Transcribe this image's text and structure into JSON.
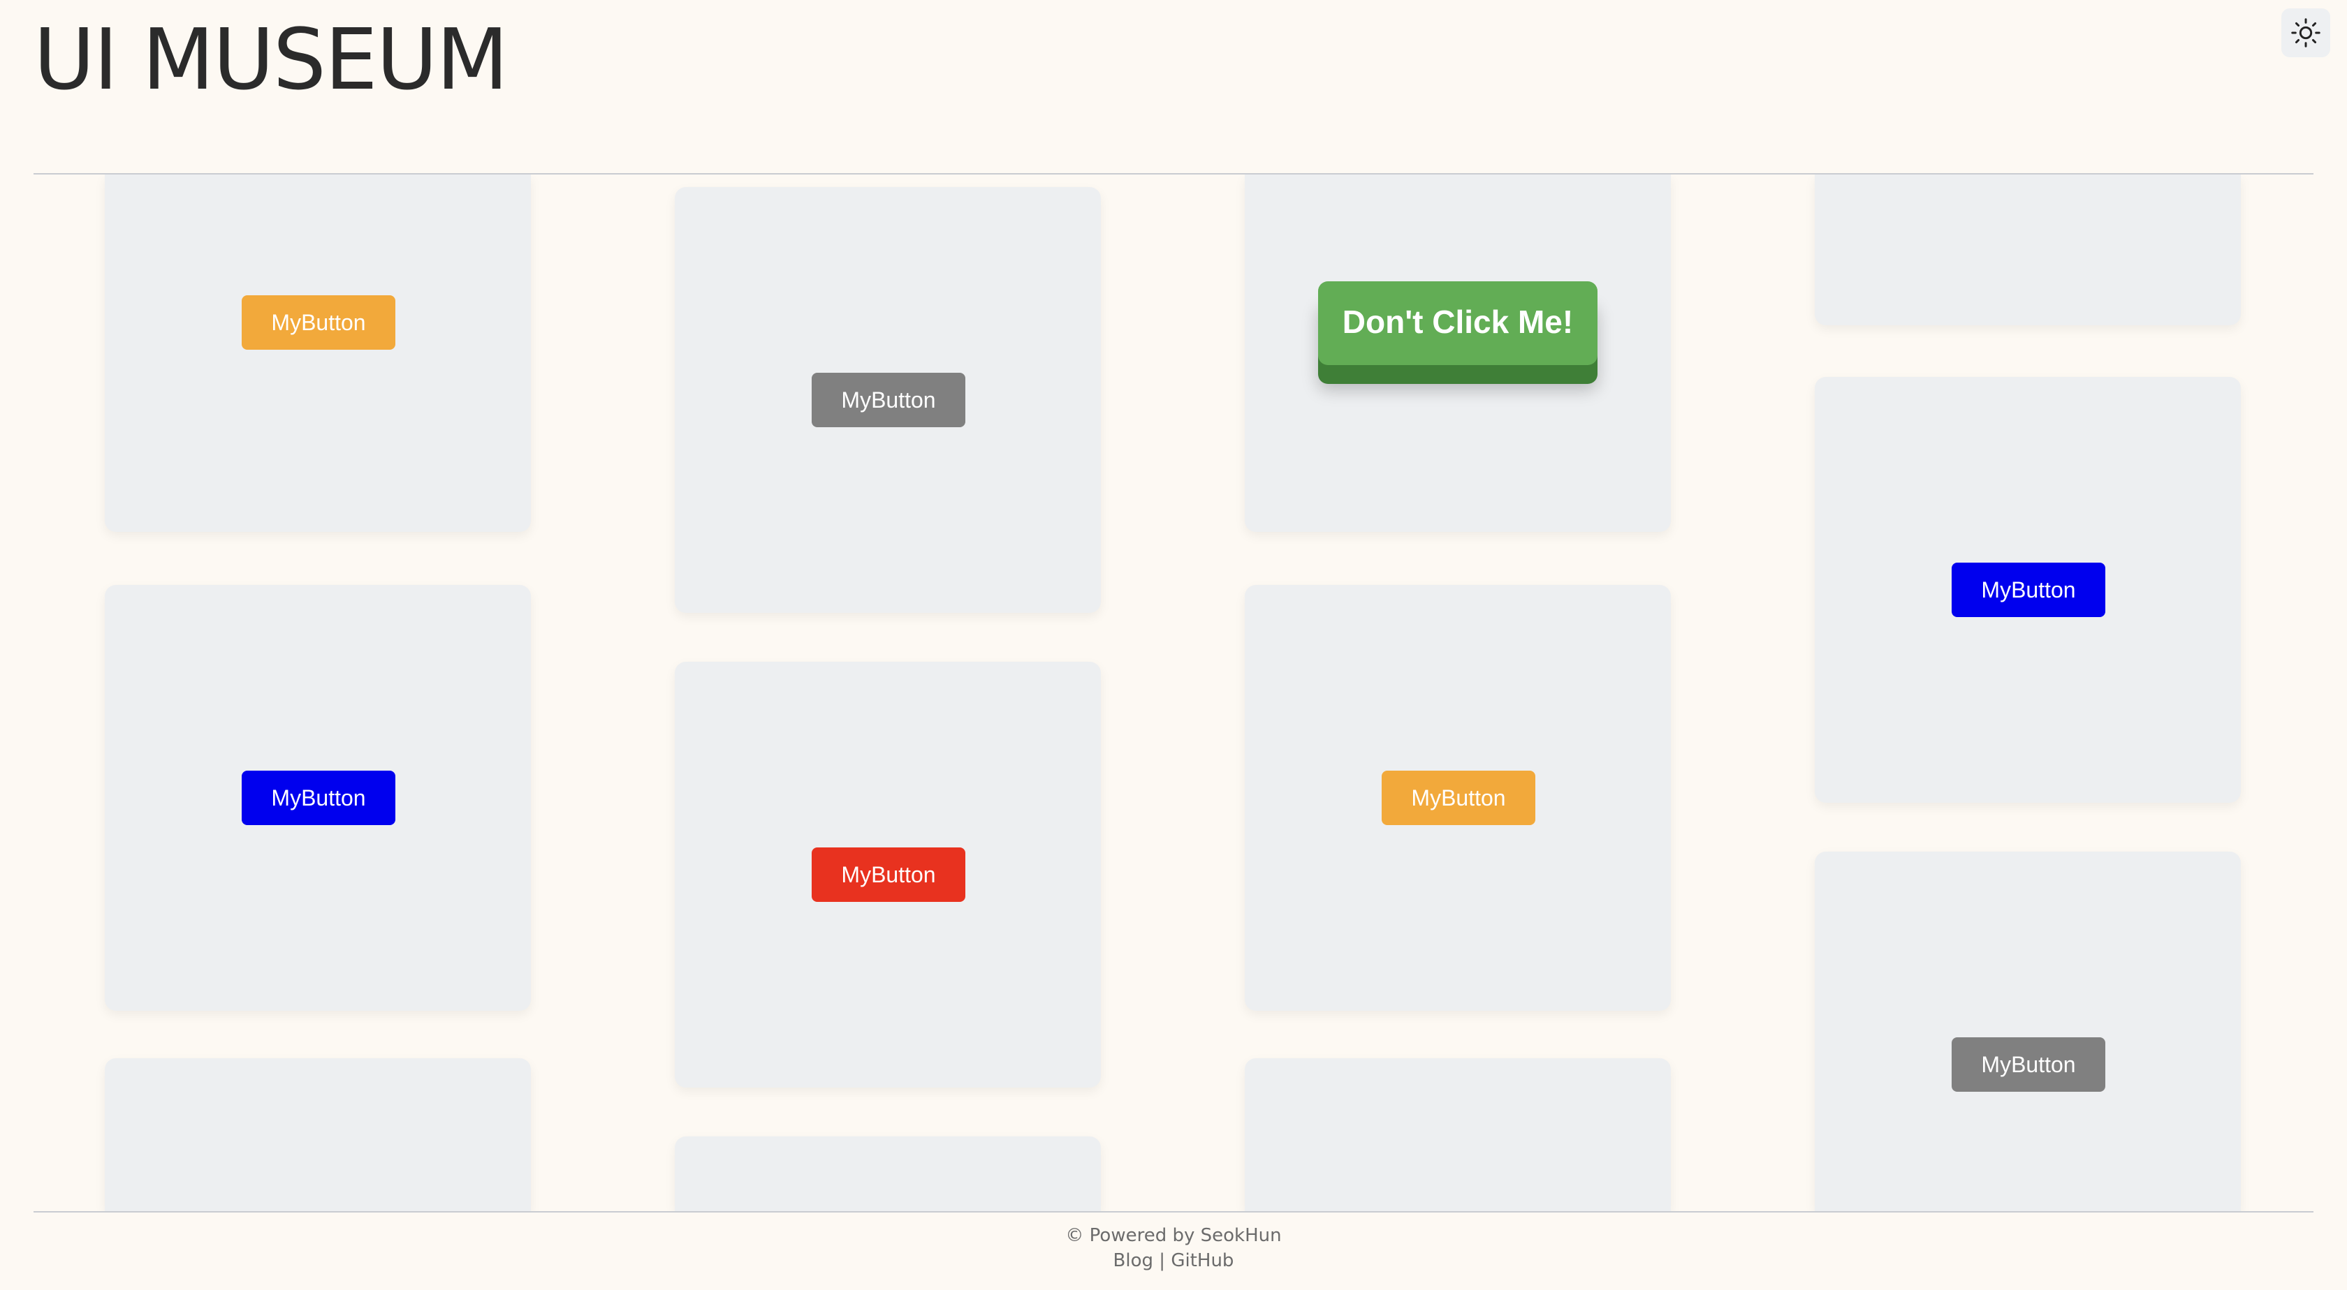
{
  "header": {
    "title": "UI MUSEUM",
    "theme_toggle_icon": "sun-icon"
  },
  "buttons": {
    "my_button_label": "MyButton",
    "dont_click_label": "Don't Click Me!"
  },
  "colors": {
    "background": "#fdf9f3",
    "card": "#edeff1",
    "orange": "#f2a93b",
    "gray": "#808080",
    "blue": "#0000ee",
    "red": "#e8321f",
    "green": "#62ad55",
    "green_shadow": "#3f7f37"
  },
  "footer": {
    "copyright": "© Powered by SeokHun",
    "blog_link": "Blog",
    "separator": "|",
    "github_link": "GitHub"
  }
}
